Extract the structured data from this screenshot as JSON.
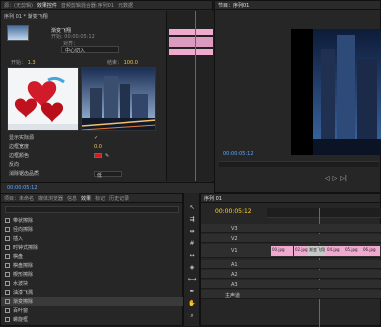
{
  "top_tabs_left": [
    "源：(无剪辑)",
    "效果控件",
    "音频剪辑混合器:序列01",
    "元数据"
  ],
  "top_tabs_right": [
    "节目：序列01"
  ],
  "effect_controls": {
    "seq_label": "序列 01 * 渐变飞翔",
    "clip_name": "渐变飞翔",
    "clip_info": "开始: 00:00:05:12",
    "alignment_label": "对齐：",
    "alignment_value": "中心切入",
    "start_label": "开始：",
    "start_value": "1.3",
    "end_label": "结束：",
    "end_value": "100.0",
    "props": [
      {
        "label": "显示实际源",
        "value": "✓"
      },
      {
        "label": "边框宽度",
        "value": "0.0"
      },
      {
        "label": "边框颜色",
        "value": ""
      },
      {
        "label": "反向",
        "value": ""
      },
      {
        "label": "消除锯齿品质",
        "value": "低"
      }
    ],
    "timecode": "00:00:05:12"
  },
  "program": {
    "timecode": "00:00:05:12",
    "top_label": "开始: 00:00:05:12"
  },
  "project_tabs": [
    "项目：未命名",
    "媒体浏览器",
    "信息",
    "效果",
    "标记",
    "历史记录"
  ],
  "effects_list": [
    {
      "label": "带状擦除"
    },
    {
      "label": "径向擦除"
    },
    {
      "label": "插入"
    },
    {
      "label": "时钟式擦除"
    },
    {
      "label": "棋盘"
    },
    {
      "label": "棋盘擦除"
    },
    {
      "label": "楔形擦除"
    },
    {
      "label": "水波块"
    },
    {
      "label": "油漆飞溅"
    },
    {
      "label": "渐变擦除"
    },
    {
      "label": "百叶窗"
    },
    {
      "label": "螺旋框"
    }
  ],
  "timeline": {
    "tab": "序列 01",
    "timecode": "00:00:05:12",
    "tracks": [
      "V3",
      "V2",
      "V1",
      "A1",
      "A2",
      "A3",
      "主声道"
    ],
    "clips": [
      "00.jpg",
      "02.jpg",
      "渐变飞翔",
      "04.jpg",
      "05.jpg",
      "06.jpg"
    ]
  }
}
